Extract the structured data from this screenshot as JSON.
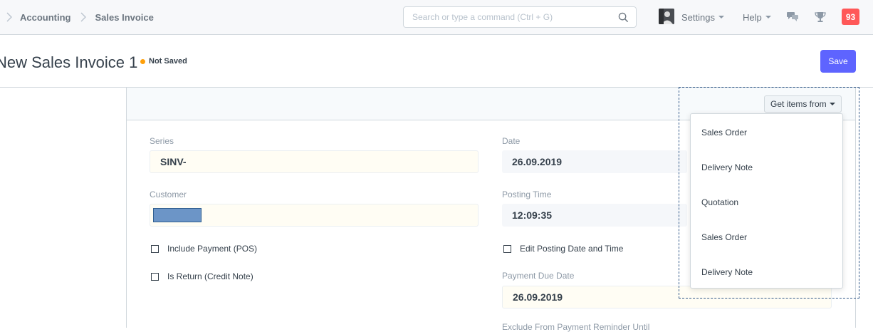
{
  "navbar": {
    "breadcrumbs": [
      "Accounting",
      "Sales Invoice"
    ],
    "search": {
      "placeholder": "Search or type a command (Ctrl + G)",
      "value": ""
    },
    "settings_label": "Settings",
    "help_label": "Help",
    "notification_count": "93",
    "icons": [
      "search-icon",
      "chat-icon",
      "trophy-icon"
    ]
  },
  "header": {
    "title": "New Sales Invoice 1",
    "status": "Not Saved",
    "status_color": "#ffa00a",
    "save_label": "Save",
    "accent": "#5e64ff"
  },
  "toolbar": {
    "get_items_label": "Get items from",
    "menu_items": [
      "Sales Order",
      "Delivery Note",
      "Quotation",
      "Sales Order",
      "Delivery Note"
    ]
  },
  "form": {
    "series": {
      "label": "Series",
      "value": "SINV-"
    },
    "customer": {
      "label": "Customer",
      "value": ""
    },
    "include_payment": {
      "label": "Include Payment (POS)",
      "checked": false
    },
    "is_return": {
      "label": "Is Return (Credit Note)",
      "checked": false
    },
    "date": {
      "label": "Date",
      "value": "26.09.2019"
    },
    "posting_time": {
      "label": "Posting Time",
      "value": "12:09:35"
    },
    "edit_posting": {
      "label": "Edit Posting Date and Time",
      "checked": false
    },
    "payment_due_date": {
      "label": "Payment Due Date",
      "value": "26.09.2019"
    },
    "exclude_reminder": {
      "label": "Exclude From Payment Reminder Until"
    }
  }
}
